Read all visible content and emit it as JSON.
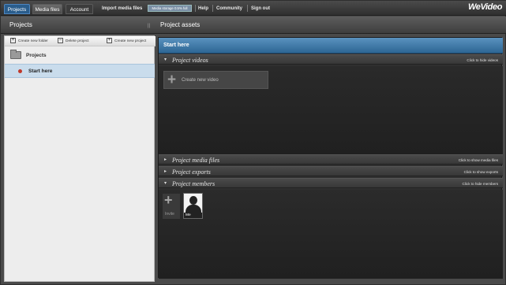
{
  "nav": {
    "tabs": [
      {
        "label": "Projects"
      },
      {
        "label": "Media files"
      },
      {
        "label": "Account"
      }
    ],
    "import_label": "Import media files",
    "storage_label": "Media storage 0.5% full",
    "storage_used_percent": 0.5,
    "help_label": "Help",
    "community_label": "Community",
    "signout_label": "Sign out",
    "logo_text": "WeVideo"
  },
  "subbar": {
    "projects_title": "Projects",
    "assets_title": "Project assets"
  },
  "sidebar": {
    "tools": [
      {
        "label": "Create new folder",
        "icon": "new-folder-icon"
      },
      {
        "label": "Delete project",
        "icon": "delete-icon"
      },
      {
        "label": "Create new project",
        "icon": "new-project-icon"
      }
    ],
    "folder_label": "Projects",
    "project_label": "Start here"
  },
  "assets": {
    "header": "Start here",
    "videos": {
      "title": "Project videos",
      "hint": "Click to hide videos",
      "create_label": "Create new video"
    },
    "media": {
      "title": "Project media files",
      "hint": "Click to show media files"
    },
    "exports": {
      "title": "Project exports",
      "hint": "Click to show exports"
    },
    "members": {
      "title": "Project members",
      "hint": "Click to hide members",
      "invite_label": "Invite",
      "me_label": "Me"
    }
  },
  "colors": {
    "accent_blue": "#2d6694",
    "active_tab": "#2a5d8c",
    "project_dot": "#c0392b",
    "selected_row": "#c9dcec"
  }
}
